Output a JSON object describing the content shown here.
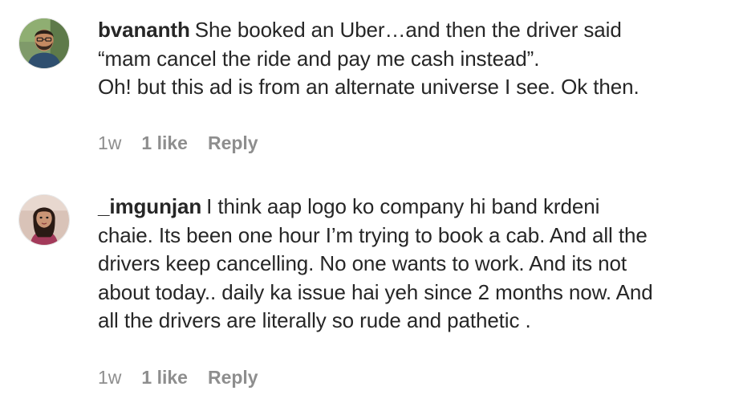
{
  "comments": [
    {
      "username": "bvananth",
      "text": "She booked an Uber…and then the driver said\n“mam cancel the ride and pay me cash instead”.\nOh! but this ad is from an alternate universe I see. Ok then.",
      "time": "1w",
      "likes": "1 like",
      "reply": "Reply",
      "avatar_icon": "man-with-beard-avatar"
    },
    {
      "username": "_imgunjan",
      "text": "I think aap logo ko company hi band krdeni\nchaie. Its been one hour I’m trying to book a cab. And all the\ndrivers keep cancelling. No one wants to work. And its not\nabout today.. daily ka issue hai yeh since 2 months now. And\nall the drivers are literally so rude and pathetic .",
      "time": "1w",
      "likes": "1 like",
      "reply": "Reply",
      "avatar_icon": "woman-avatar"
    }
  ],
  "colors": {
    "text": "#262626",
    "meta": "#8e8e8e",
    "background": "#ffffff"
  }
}
